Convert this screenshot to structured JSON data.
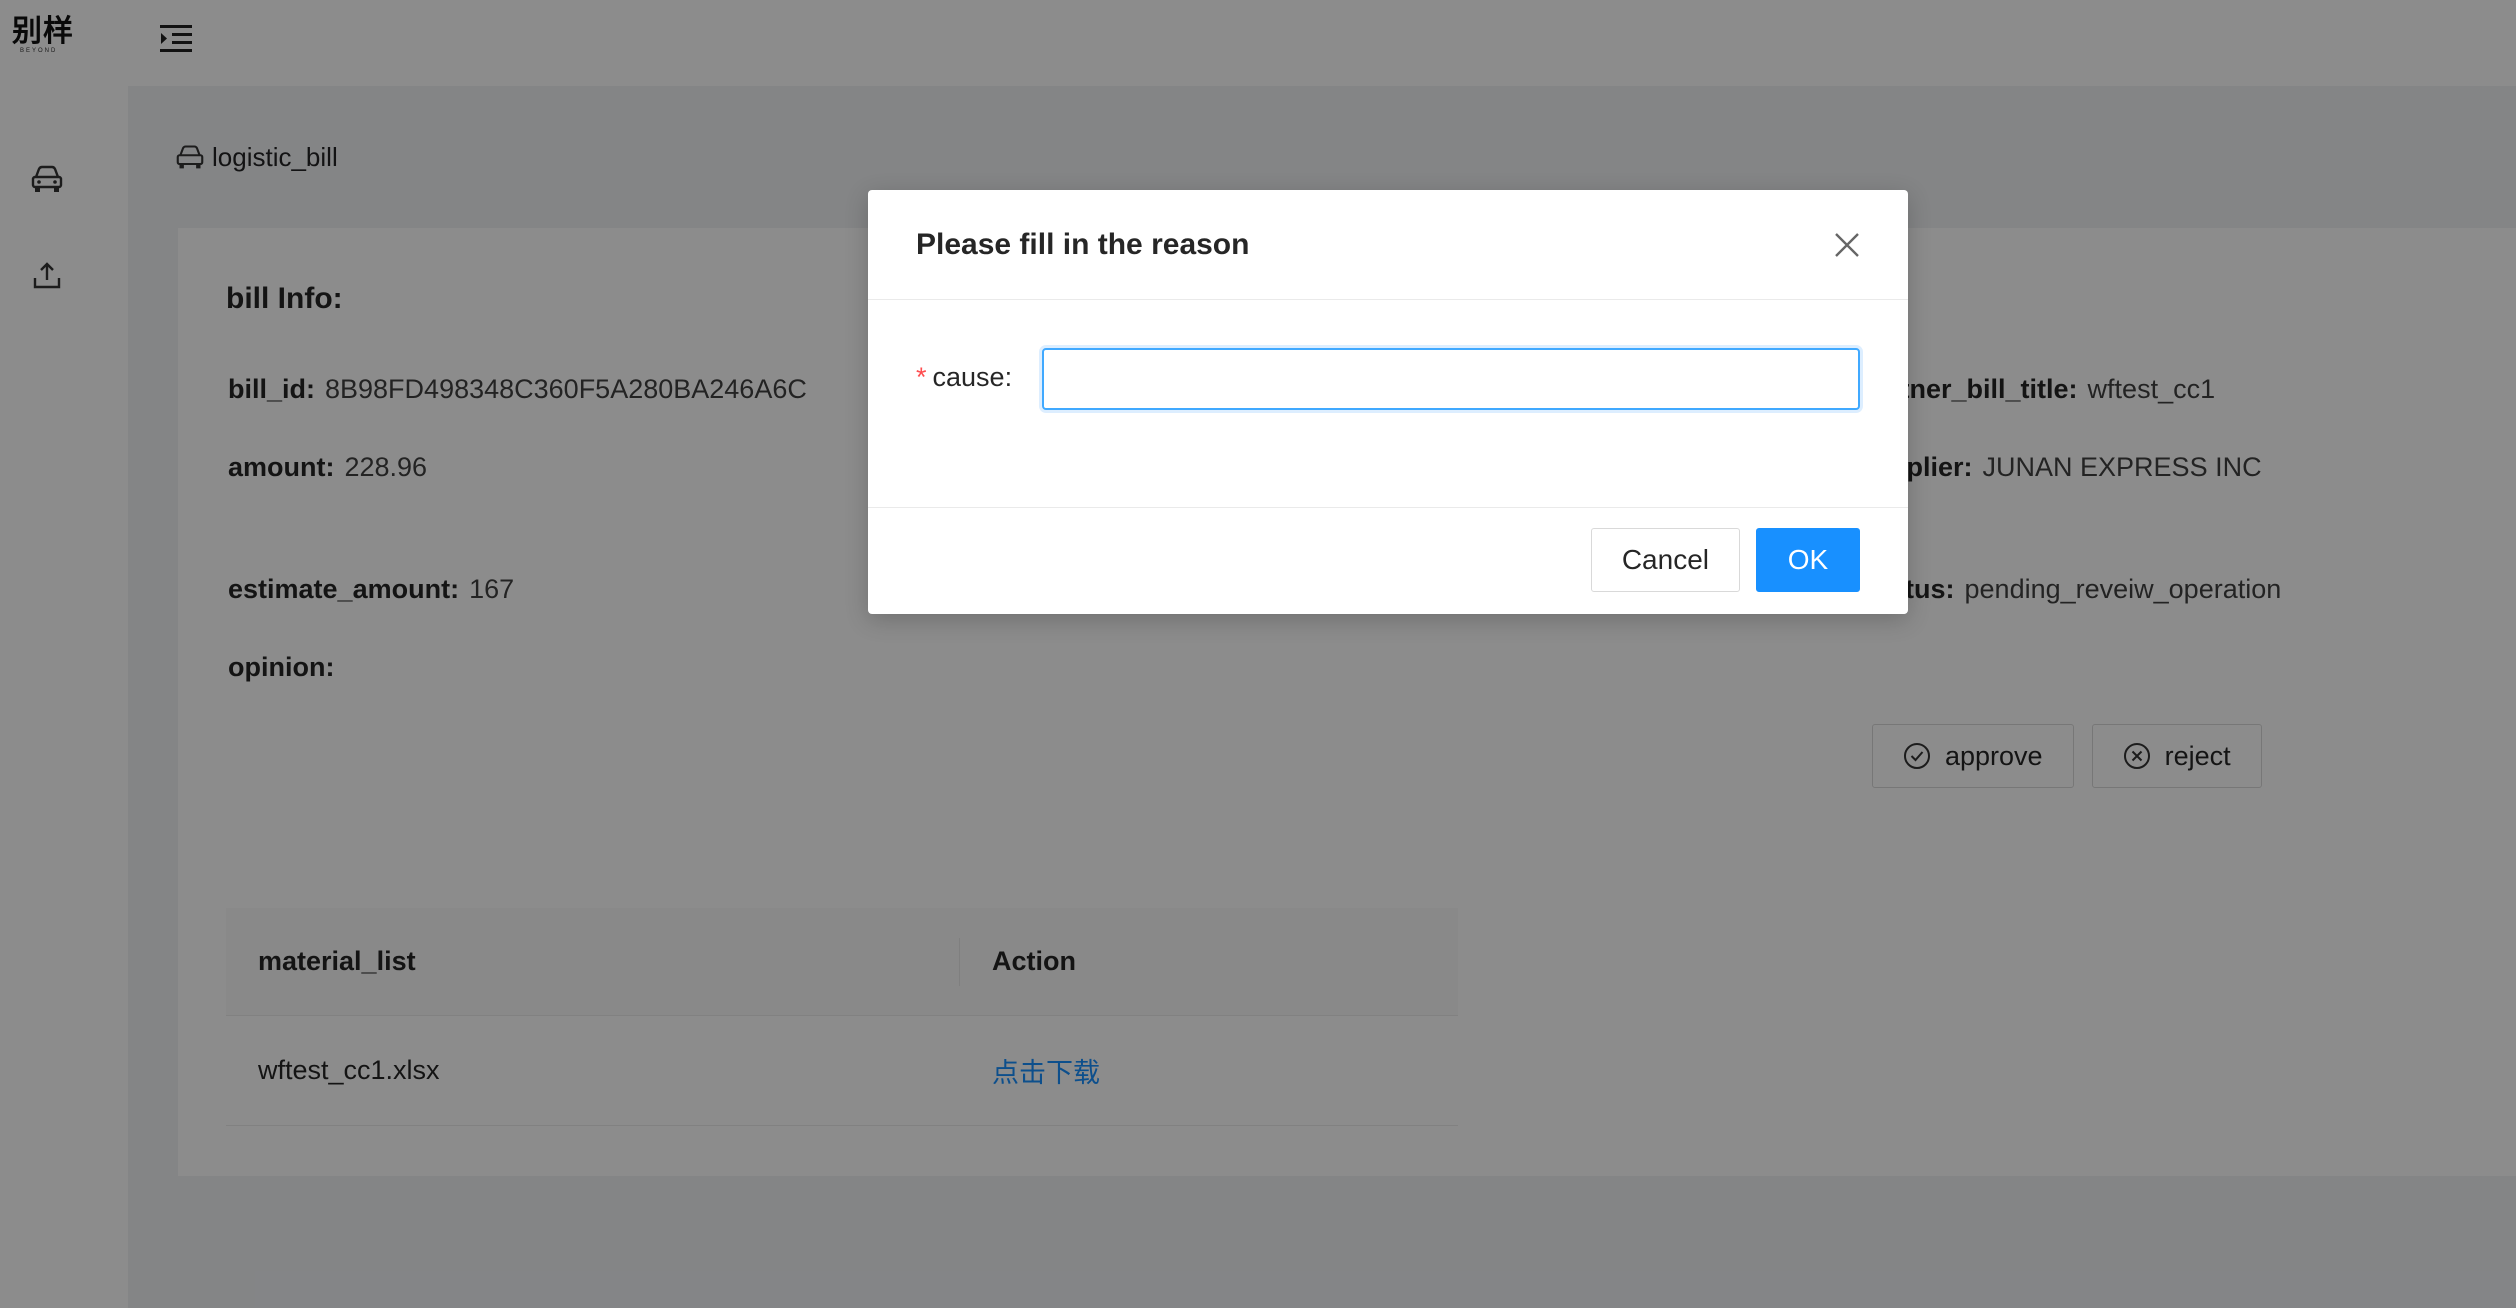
{
  "header": {
    "logo_text": "别样",
    "logo_subtext": "BEYOND",
    "menu_icon": "menu-unfold-icon"
  },
  "sidebar": {
    "items": [
      {
        "icon": "car-icon"
      },
      {
        "icon": "upload-icon"
      }
    ]
  },
  "breadcrumb": {
    "icon": "car-icon",
    "label": "logistic_bill"
  },
  "bill": {
    "title": "bill Info:",
    "fields": {
      "bill_id": {
        "label": "bill_id:",
        "value": "8B98FD498348C360F5A280BA246A6C"
      },
      "amount": {
        "label": "amount:",
        "value": "228.96"
      },
      "estimate_amount": {
        "label": "estimate_amount:",
        "value": "167"
      },
      "opinion": {
        "label": "opinion:",
        "value": ""
      },
      "partner_bill_title": {
        "label": "rtner_bill_title:",
        "value": "wftest_cc1"
      },
      "supplier": {
        "label": "pplier:",
        "value": "JUNAN EXPRESS INC"
      },
      "status": {
        "label": "atus:",
        "value": "pending_reveiw_operation"
      }
    },
    "actions": {
      "approve_label": "approve",
      "reject_label": "reject"
    }
  },
  "table": {
    "columns": [
      "material_list",
      "Action"
    ],
    "rows": [
      {
        "file": "wftest_cc1.xlsx",
        "action": "点击下载"
      }
    ]
  },
  "modal": {
    "title": "Please fill in the reason",
    "field_label": "cause:",
    "field_value": "",
    "field_placeholder": "",
    "cancel_label": "Cancel",
    "ok_label": "OK"
  },
  "colors": {
    "primary": "#1890ff",
    "required": "#ff4d4f",
    "mask": "rgba(0,0,0,0.45)"
  }
}
